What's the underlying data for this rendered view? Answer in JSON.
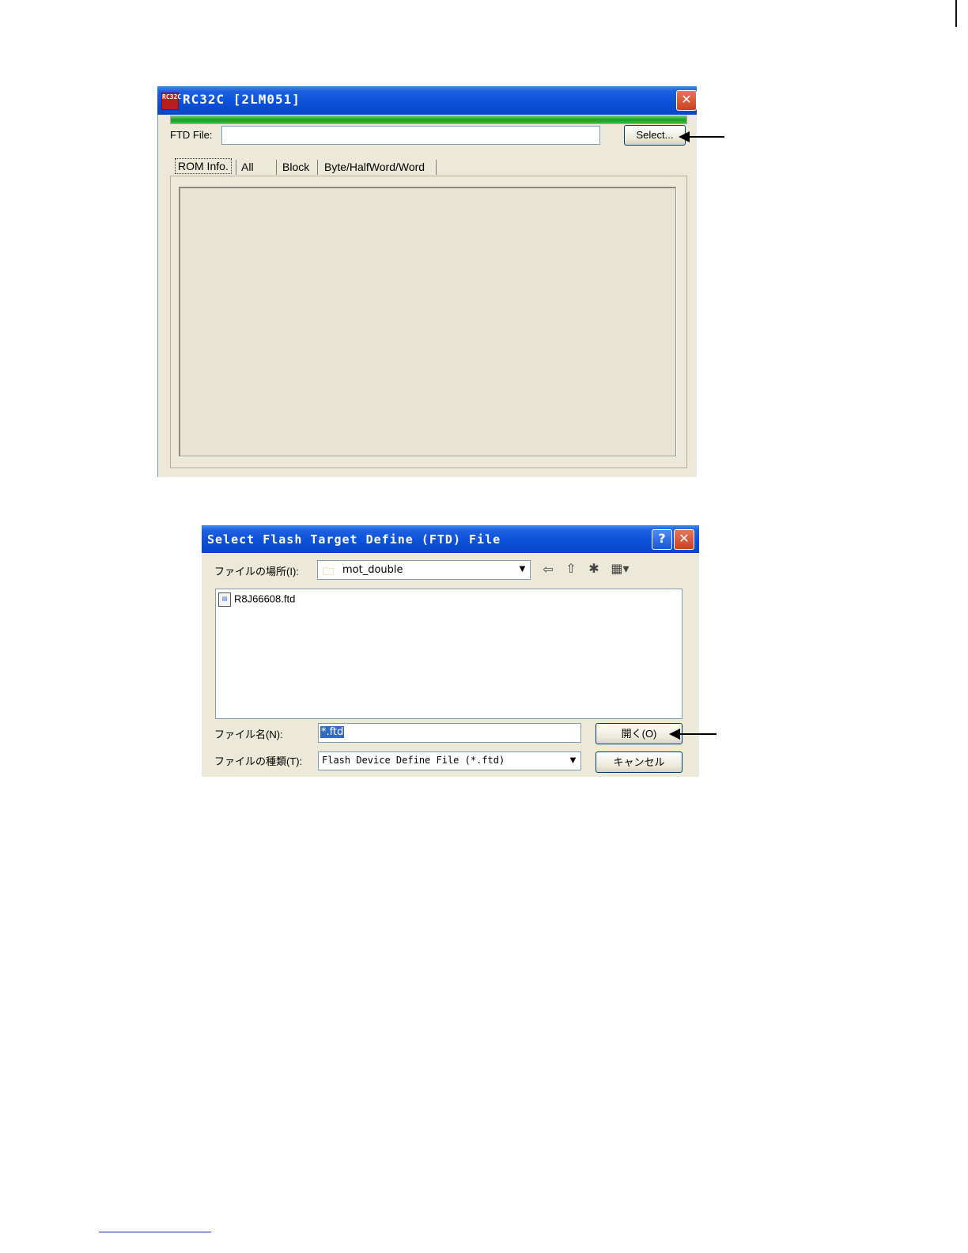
{
  "window1": {
    "title": "RC32C [2LM051]",
    "app_icon_text": "RC32C",
    "progress": 1.0,
    "progress_color": "#1a9e2a",
    "ftd_label": "FTD File:",
    "ftd_value": "",
    "select_button": "Select...",
    "tabs": [
      {
        "label": "ROM Info.",
        "active": true
      },
      {
        "label": "All",
        "active": false
      },
      {
        "label": "Block",
        "active": false
      },
      {
        "label": "Byte/HalfWord/Word",
        "active": false
      }
    ],
    "close_icon": "close-icon"
  },
  "window2": {
    "title": "Select Flash Target Define (FTD) File",
    "look_in_label": "ファイルの場所(I):",
    "look_in_value": "mot_double",
    "toolbar_icons": [
      "back-arrow-icon",
      "up-folder-icon",
      "new-folder-icon",
      "view-menu-icon"
    ],
    "files": [
      {
        "name": "R8J66608.ftd",
        "icon": "ftd-file-icon"
      }
    ],
    "filename_label": "ファイル名(N):",
    "filename_value": "*.ftd",
    "filetype_label": "ファイルの種類(T):",
    "filetype_value": "Flash Device Define File (*.ftd)",
    "open_button": "開く(O)",
    "cancel_button": "キャンセル",
    "help_icon": "help-icon",
    "close_icon": "close-icon"
  },
  "colors": {
    "titlebar": "#0a50d8",
    "window_bg": "#ece9d8",
    "selection": "#316ac5"
  }
}
